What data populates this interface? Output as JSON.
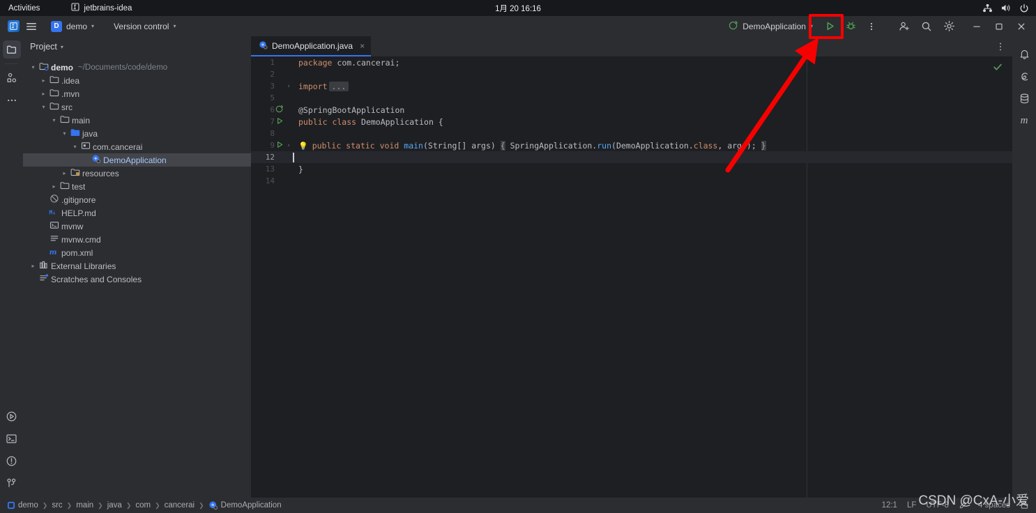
{
  "desktop": {
    "activities": "Activities",
    "app_name": "jetbrains-idea",
    "clock": "1月 20  16:16",
    "tray": [
      "network-icon",
      "volume-icon",
      "power-icon"
    ]
  },
  "toolbar": {
    "main_menu_icon": "hamburger-menu-icon",
    "logo": "intellij-idea-logo",
    "project_badge": "D",
    "project_name": "demo",
    "vcs_label": "Version control",
    "run_config": "DemoApplication",
    "run_icon": "run-triangle-icon",
    "debug_icon": "debug-icon",
    "more_icon": "more-vertical-icon",
    "account_icon": "add-user-icon",
    "search_icon": "search-icon",
    "settings_icon": "gear-icon",
    "minimize": "minimize-icon",
    "maximize": "maximize-icon",
    "close": "close-icon"
  },
  "left_rail": {
    "top": [
      {
        "name": "project-icon",
        "active": true
      },
      {
        "name": "commit-icon",
        "active": false
      },
      {
        "name": "more-dots-icon",
        "active": false
      }
    ],
    "bottom": [
      {
        "name": "run-icon"
      },
      {
        "name": "terminal-icon"
      },
      {
        "name": "problems-icon"
      },
      {
        "name": "version-control-branch-icon"
      }
    ]
  },
  "right_rail": [
    {
      "name": "notifications-bell-icon"
    },
    {
      "name": "ai-assistant-icon"
    },
    {
      "name": "database-icon"
    },
    {
      "name": "maven-icon"
    }
  ],
  "project_panel": {
    "title": "Project",
    "tree": [
      {
        "depth": 0,
        "twisty": "down",
        "icon": "module-folder-icon",
        "label": "demo",
        "bold": true,
        "hint": "~/Documents/code/demo",
        "selected": false
      },
      {
        "depth": 1,
        "twisty": "right",
        "icon": "folder-icon",
        "label": ".idea",
        "selected": false
      },
      {
        "depth": 1,
        "twisty": "right",
        "icon": "folder-icon",
        "label": ".mvn",
        "selected": false
      },
      {
        "depth": 1,
        "twisty": "down",
        "icon": "folder-icon",
        "label": "src",
        "selected": false
      },
      {
        "depth": 2,
        "twisty": "down",
        "icon": "folder-icon",
        "label": "main",
        "selected": false
      },
      {
        "depth": 3,
        "twisty": "down",
        "icon": "source-folder-icon",
        "label": "java",
        "selected": false
      },
      {
        "depth": 4,
        "twisty": "down",
        "icon": "package-icon",
        "label": "com.cancerai",
        "selected": false
      },
      {
        "depth": 5,
        "twisty": "none",
        "icon": "spring-class-icon",
        "label": "DemoApplication",
        "selected": true
      },
      {
        "depth": 3,
        "twisty": "right",
        "icon": "resources-folder-icon",
        "label": "resources",
        "selected": false
      },
      {
        "depth": 2,
        "twisty": "right",
        "icon": "folder-icon",
        "label": "test",
        "selected": false
      },
      {
        "depth": 1,
        "twisty": "none",
        "icon": "gitignore-icon",
        "label": ".gitignore",
        "selected": false
      },
      {
        "depth": 1,
        "twisty": "none",
        "icon": "markdown-icon",
        "label": "HELP.md",
        "selected": false
      },
      {
        "depth": 1,
        "twisty": "none",
        "icon": "shell-script-icon",
        "label": "mvnw",
        "selected": false
      },
      {
        "depth": 1,
        "twisty": "none",
        "icon": "cmd-file-icon",
        "label": "mvnw.cmd",
        "selected": false
      },
      {
        "depth": 1,
        "twisty": "none",
        "icon": "maven-pom-icon",
        "label": "pom.xml",
        "selected": false
      },
      {
        "depth": 0,
        "twisty": "right",
        "icon": "external-libraries-icon",
        "label": "External Libraries",
        "selected": false
      },
      {
        "depth": 0,
        "twisty": "none",
        "icon": "scratches-icon",
        "label": "Scratches and Consoles",
        "selected": false
      }
    ]
  },
  "editor": {
    "tab": {
      "label": "DemoApplication.java",
      "icon": "spring-class-icon",
      "close": "×"
    },
    "tab_actions_icon": "more-vertical-icon",
    "inspection_status_icon": "check-ok-icon",
    "lines": [
      {
        "num": "1",
        "gutter": "",
        "fold": "",
        "current": false,
        "tokens": [
          {
            "t": "kw",
            "v": "package"
          },
          {
            "t": "ident",
            "v": " com.cancerai;"
          }
        ]
      },
      {
        "num": "2",
        "gutter": "",
        "fold": "",
        "current": false,
        "tokens": []
      },
      {
        "num": "3",
        "gutter": "",
        "fold": "right",
        "current": false,
        "tokens": [
          {
            "t": "kw",
            "v": "import"
          },
          {
            "t": "folded",
            "v": "..."
          }
        ]
      },
      {
        "num": "5",
        "gutter": "",
        "fold": "",
        "current": false,
        "tokens": []
      },
      {
        "num": "6",
        "gutter": "spring-bean-icon",
        "fold": "",
        "current": false,
        "tokens": [
          {
            "t": "ann",
            "v": "@SpringBootApplication"
          }
        ]
      },
      {
        "num": "7",
        "gutter": "run-gutter-icon",
        "fold": "",
        "current": false,
        "tokens": [
          {
            "t": "kw",
            "v": "public class"
          },
          {
            "t": "ident",
            "v": " DemoApplication {"
          }
        ]
      },
      {
        "num": "8",
        "gutter": "",
        "fold": "",
        "current": false,
        "tokens": []
      },
      {
        "num": "9",
        "gutter": "run-gutter-icon",
        "fold": "right",
        "current": false,
        "bulb": true,
        "tokens": [
          {
            "t": "kw",
            "v": "public static void "
          },
          {
            "t": "meth",
            "v": "main"
          },
          {
            "t": "ident",
            "v": "(String[] args) "
          },
          {
            "t": "brace",
            "v": "{"
          },
          {
            "t": "ident",
            "v": " SpringApplication."
          },
          {
            "t": "methi",
            "v": "run"
          },
          {
            "t": "ident",
            "v": "(DemoApplication."
          },
          {
            "t": "kw",
            "v": "class"
          },
          {
            "t": "ident",
            "v": ", args); "
          },
          {
            "t": "brace",
            "v": "}"
          }
        ]
      },
      {
        "num": "12",
        "gutter": "",
        "fold": "",
        "current": true,
        "tokens": []
      },
      {
        "num": "13",
        "gutter": "",
        "fold": "",
        "current": false,
        "tokens": [
          {
            "t": "ident",
            "v": "}"
          }
        ]
      },
      {
        "num": "14",
        "gutter": "",
        "fold": "",
        "current": false,
        "tokens": []
      }
    ]
  },
  "status_bar": {
    "breadcrumb": [
      {
        "icon": "module-icon",
        "label": "demo"
      },
      {
        "icon": "",
        "label": "src"
      },
      {
        "icon": "",
        "label": "main"
      },
      {
        "icon": "",
        "label": "java"
      },
      {
        "icon": "",
        "label": "com"
      },
      {
        "icon": "",
        "label": "cancerai"
      },
      {
        "icon": "spring-class-icon",
        "label": "DemoApplication"
      }
    ],
    "caret_position": "12:1",
    "line_separator": "LF",
    "encoding": "UTF-8",
    "indent": "4 spaces",
    "lock_icon": "lock-icon",
    "edit_icon": "edit-readonly-icon"
  },
  "annotations": {
    "highlight_color": "#f70000",
    "watermark": "CSDN @CxA-小爱"
  }
}
